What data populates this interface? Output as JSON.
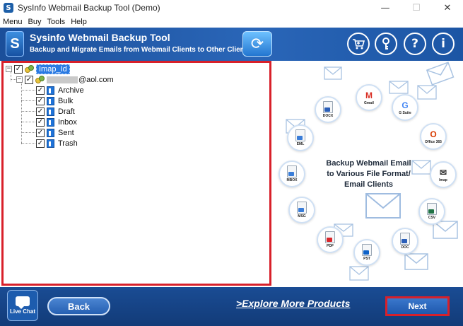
{
  "window": {
    "title": "SysInfo Webmail Backup Tool (Demo)",
    "app_icon_letter": "S",
    "controls": {
      "minimize": "—",
      "maximize": "☐",
      "close": "✕"
    }
  },
  "menu": [
    "Menu",
    "Buy",
    "Tools",
    "Help"
  ],
  "header": {
    "logo_letter": "S",
    "title": "Sysinfo Webmail Backup Tool",
    "subtitle": "Backup and Migrate Emails from Webmail Clients to Other Clients",
    "buttons": [
      {
        "name": "cart-icon",
        "glyph": "🛒"
      },
      {
        "name": "key-icon",
        "glyph": "⚷"
      },
      {
        "name": "help-icon",
        "glyph": "?"
      },
      {
        "name": "info-icon",
        "glyph": "i"
      }
    ]
  },
  "tree": {
    "root": {
      "label": "Imap_Id",
      "checked": true,
      "expander": "−"
    },
    "account": {
      "label": "@aol.com",
      "checked": true,
      "expander": "−"
    },
    "folders": [
      {
        "label": "Archive",
        "checked": true
      },
      {
        "label": "Bulk",
        "checked": true
      },
      {
        "label": "Draft",
        "checked": true
      },
      {
        "label": "Inbox",
        "checked": true
      },
      {
        "label": "Sent",
        "checked": true
      },
      {
        "label": "Trash",
        "checked": true
      }
    ],
    "check_glyph": "✓"
  },
  "promo": {
    "line1": "Backup Webmail Email",
    "line2": "to Various File Format/",
    "line3": "Email Clients",
    "formats": {
      "docx": "DOCX",
      "gmail": "Gmail",
      "gsuite": "G Suite",
      "eml": "EML",
      "office365": "Office 365",
      "mbox": "MBOX",
      "imap": "Imap",
      "msg": "MSG",
      "csv": "CSV",
      "pdf": "PDF",
      "pst": "PST",
      "doc": "DOC"
    }
  },
  "footer": {
    "live_chat": "Live Chat",
    "back": "Back",
    "explore": ">Explore More Products",
    "next": "Next"
  },
  "colors": {
    "header_blue": "#1b4f9a",
    "highlight_red": "#d8202a",
    "selection_blue": "#2a7ae2",
    "footer_blue": "#123b78"
  }
}
